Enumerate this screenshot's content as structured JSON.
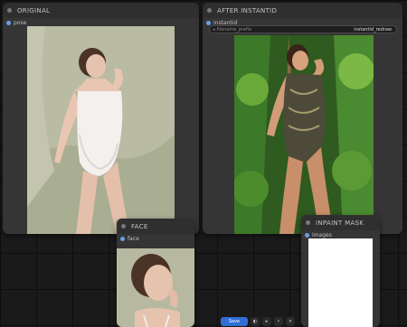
{
  "nodes": {
    "original": {
      "title": "ORIGINAL",
      "slot_label": "pose"
    },
    "after_instantid": {
      "title": "AFTER INSTANTID",
      "slot_label": "instantid",
      "widget_label": "filename_prefix",
      "widget_value": "instantid_redraw"
    },
    "face": {
      "title": "FACE",
      "slot_label": "face"
    },
    "inpaint_mask": {
      "title": "INPAINT MASK",
      "slot_label": "images"
    }
  },
  "toolbar": {
    "group_button_label": "Save"
  },
  "colors": {
    "node_bg": "#353535",
    "canvas_bg": "#1a1a1a",
    "slot_blue": "#6aa0e0",
    "toolbar_blue": "#2f6fd6"
  }
}
